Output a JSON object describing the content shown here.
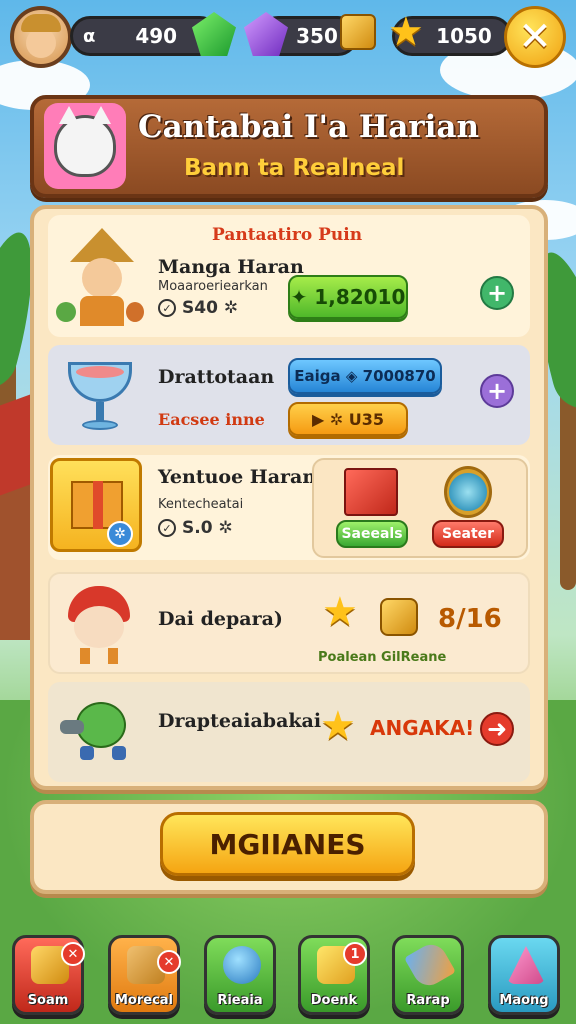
{
  "topbar": {
    "currencies": [
      {
        "value": "490",
        "prefix": "α"
      },
      {
        "value": "350"
      },
      {
        "value": "1050"
      }
    ]
  },
  "header": {
    "title": "Cantabai I'a Harian",
    "subtitle": "Bann ta Realneal"
  },
  "panel": {
    "caption": "Pantaatiro Puin",
    "items": [
      {
        "title": "Manga Haran",
        "sub": "Moaaroeriearkan",
        "price": "S40 ✲",
        "button": "✦ 1,82010"
      },
      {
        "title": "Drattotaan",
        "red": "Eacsee inne",
        "button1": "Eaiga ◈ 7000870",
        "button2": "▶ ✲ U35"
      },
      {
        "title": "Yentuoe Haram",
        "sub": "Kentecheatai",
        "price": "S.0 ✲",
        "btn_left": "Saeeals",
        "btn_right": "Seater"
      },
      {
        "title": "Dai depara)",
        "reward_text": "8/16",
        "reward_sub": "Poalean GilReane"
      },
      {
        "title": "Drapteaiabakai",
        "reward_text": "ANGAKA!"
      }
    ]
  },
  "bottom": {
    "main_button": "MGIIANES"
  },
  "nav": {
    "items": [
      {
        "label": "Soam"
      },
      {
        "label": "Morecal"
      },
      {
        "label": "Rieaia"
      },
      {
        "label": "Doenk",
        "badge": "1"
      },
      {
        "label": "Rarap"
      },
      {
        "label": "Maong"
      }
    ]
  },
  "colors": {
    "accent": "#f5a512",
    "panel": "#fbe7c3",
    "header": "#8b4a22"
  }
}
